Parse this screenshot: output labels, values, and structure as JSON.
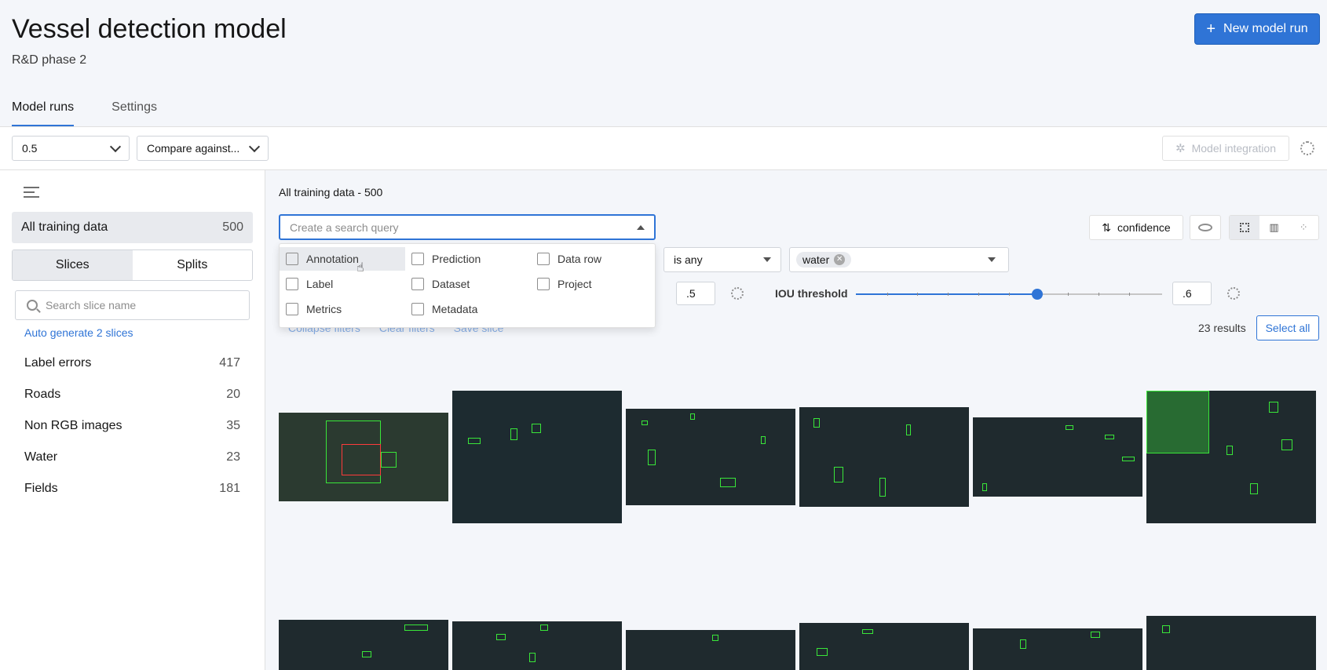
{
  "header": {
    "title": "Vessel detection model",
    "subtitle": "R&D phase 2",
    "new_run_label": "New model run",
    "new_run_icon": "plus-icon"
  },
  "tabs": [
    {
      "label": "Model runs",
      "active": true
    },
    {
      "label": "Settings",
      "active": false
    }
  ],
  "toolbar": {
    "run_value": "0.5",
    "compare_label": "Compare against...",
    "integration_label": "Model integration"
  },
  "sidebar": {
    "all_label": "All training data",
    "all_count": "500",
    "toggle": [
      "Slices",
      "Splits"
    ],
    "search_placeholder": "Search slice name",
    "autogen_label": "Auto generate 2 slices",
    "slices": [
      {
        "name": "Label errors",
        "count": "417"
      },
      {
        "name": "Roads",
        "count": "20"
      },
      {
        "name": "Non RGB images",
        "count": "35"
      },
      {
        "name": "Water",
        "count": "23"
      },
      {
        "name": "Fields",
        "count": "181"
      }
    ]
  },
  "main": {
    "heading": "All training data - 500",
    "query_placeholder": "Create a search query",
    "dropdown": [
      [
        "Annotation",
        "Prediction",
        "Data row"
      ],
      [
        "Label",
        "Dataset",
        "Project"
      ],
      [
        "Metrics",
        "Metadata"
      ]
    ],
    "filter_op": "is any",
    "filter_chip": "water",
    "conf_value": ".5",
    "iou_label": "IOU threshold",
    "iou_value": ".6",
    "iou_fraction": 0.6,
    "sort_label": "confidence",
    "links": [
      "Collapse filters",
      "Clear filters",
      "Save slice"
    ],
    "results": "23 results",
    "select_all": "Select all"
  },
  "colors": {
    "accent": "#2f74d6",
    "box": "#39e639"
  }
}
